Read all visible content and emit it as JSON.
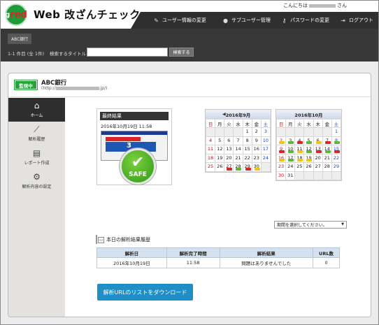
{
  "header": {
    "logo_text": "g",
    "logo_red": "red",
    "app_title": "Web 改ざんチェック",
    "greeting_prefix": "こんにちは",
    "greeting_suffix": "さん",
    "nav": [
      {
        "label": "ユーザー情報の変更",
        "icon": "edit-icon"
      },
      {
        "label": "サブユーザー管理",
        "icon": "users-icon"
      },
      {
        "label": "パスワードの変更",
        "icon": "key-icon"
      },
      {
        "label": "ログアウト",
        "icon": "logout-icon"
      }
    ]
  },
  "subbar": {
    "breadcrumb": "ABC銀行",
    "count": "1-1 件目 (全 1件)",
    "search_label": "検索するタイトル",
    "search_value": "",
    "search_button": "検索する"
  },
  "site": {
    "status": "監視中",
    "name": "ABC銀行",
    "url_prefix": "(http://",
    "url_suffix": ".jp/)"
  },
  "sidebar": [
    {
      "label": "ホーム",
      "icon": "home-icon",
      "active": true
    },
    {
      "label": "解析履歴",
      "icon": "history-chart-icon",
      "active": false
    },
    {
      "label": "レポート作成",
      "icon": "report-icon",
      "active": false
    },
    {
      "label": "解析内容の設定",
      "icon": "settings-icon",
      "active": false
    }
  ],
  "result": {
    "title": "最終結果",
    "datetime": "2016年10月19日 11:58",
    "safe_label": "SAFE",
    "thumb_number": "3"
  },
  "calendars": [
    {
      "title": "2016年9月",
      "prev_arrow": "◀",
      "weekdays": [
        "日",
        "月",
        "火",
        "水",
        "木",
        "金",
        "土"
      ],
      "weeks": [
        [
          "",
          "",
          "",
          "",
          "1",
          "2",
          "3"
        ],
        [
          "4",
          "5",
          "6",
          "7",
          "8",
          "9",
          "10"
        ],
        [
          "11",
          "12",
          "13",
          "14",
          "15",
          "16",
          "17"
        ],
        [
          "18",
          "19",
          "20",
          "21",
          "22",
          "23",
          "24"
        ],
        [
          "25",
          "26",
          "27",
          "28",
          "29",
          "30",
          ""
        ]
      ],
      "marks": {
        "4-2": "r",
        "4-3": "g",
        "4-4": "r",
        "4-5": "y"
      }
    },
    {
      "title": "2016年10月",
      "prev_arrow": "",
      "weekdays": [
        "日",
        "月",
        "火",
        "水",
        "木",
        "金",
        "土"
      ],
      "weeks": [
        [
          "",
          "",
          "",
          "",
          "",
          "",
          "1"
        ],
        [
          "2",
          "3",
          "4",
          "5",
          "6",
          "7",
          "8"
        ],
        [
          "9",
          "10",
          "11",
          "12",
          "13",
          "14",
          "15"
        ],
        [
          "16",
          "17",
          "18",
          "19",
          "20",
          "21",
          "22"
        ],
        [
          "23",
          "24",
          "25",
          "26",
          "27",
          "28",
          "29"
        ],
        [
          "30",
          "31",
          "",
          "",
          "",
          "",
          ""
        ]
      ],
      "marks": {
        "1-0": "y",
        "1-1": "g",
        "1-2": "r",
        "1-3": "g",
        "1-4": "y",
        "1-5": "r",
        "1-6": "g",
        "2-0": "r",
        "2-1": "g",
        "2-2": "y",
        "2-3": "g",
        "2-4": "r",
        "2-5": "g",
        "2-6": "r",
        "3-0": "y",
        "3-1": "g",
        "3-2": "y",
        "3-3": "y"
      }
    }
  ],
  "period_select": "期間を選択してください。",
  "history": {
    "title": "本日の解析結果履歴",
    "headers": [
      "解析日",
      "解析完了時間",
      "解析結果",
      "URL数"
    ],
    "rows": [
      [
        "2016年10月19日",
        "11:58",
        "問題はありませんでした",
        "0"
      ]
    ]
  },
  "download_button": "解析URLのリストをダウンロード",
  "colors": {
    "status_green": "#2aa13c",
    "header_dark": "#2f2f2f",
    "button_blue": "#1f8fc7",
    "marker_red": "#d9262b",
    "marker_yellow": "#f2c318",
    "marker_green": "#5bb83a"
  }
}
